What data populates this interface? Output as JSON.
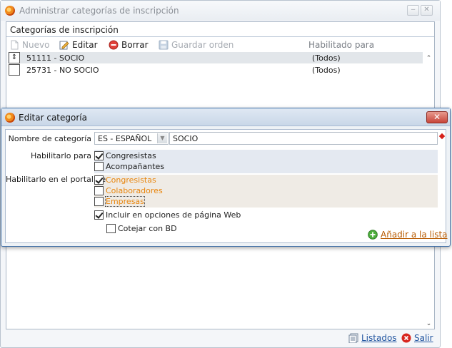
{
  "back_window": {
    "title": "Administrar categorías de inscripción",
    "panel_title": "Categorías de inscripción",
    "toolbar": {
      "new_label": "Nuevo",
      "edit_label": "Editar",
      "delete_label": "Borrar",
      "save_order_label": "Guardar orden"
    },
    "column_enabled_for": "Habilitado para",
    "rows": [
      {
        "code": "51111 - SOCIO",
        "enabled_for": "(Todos)",
        "selected": true
      },
      {
        "code": "25731 - NO SOCIO",
        "enabled_for": "(Todos)",
        "selected": false
      }
    ],
    "footer": {
      "listings_label": "Listados",
      "exit_label": "Salir"
    }
  },
  "dialog": {
    "title": "Editar categoría",
    "close_glyph": "✕",
    "name_label": "Nombre de categoría",
    "language_value": "ES - ESPAÑOL",
    "name_value": "SOCIO",
    "enable_for_label": "Habilitarlo para",
    "enable_for_options": [
      {
        "label": "Congresistas",
        "checked": true
      },
      {
        "label": "Acompañantes",
        "checked": false
      }
    ],
    "portal_label": "Habilitarlo en el portal de",
    "portal_options": [
      {
        "label": "Congresistas",
        "checked": true
      },
      {
        "label": "Colaboradores",
        "checked": false
      },
      {
        "label": "Empresas",
        "checked": false
      }
    ],
    "include_web_label": "Incluir en opciones de página Web",
    "include_web_checked": true,
    "match_bd_label": "Cotejar con BD",
    "match_bd_checked": false,
    "add_to_list_label": "Añadir a la lista"
  },
  "colors": {
    "accent_orange": "#e8850c",
    "link_blue": "#2255a0",
    "close_red": "#c8453a",
    "required_marker": "#d6201a"
  }
}
